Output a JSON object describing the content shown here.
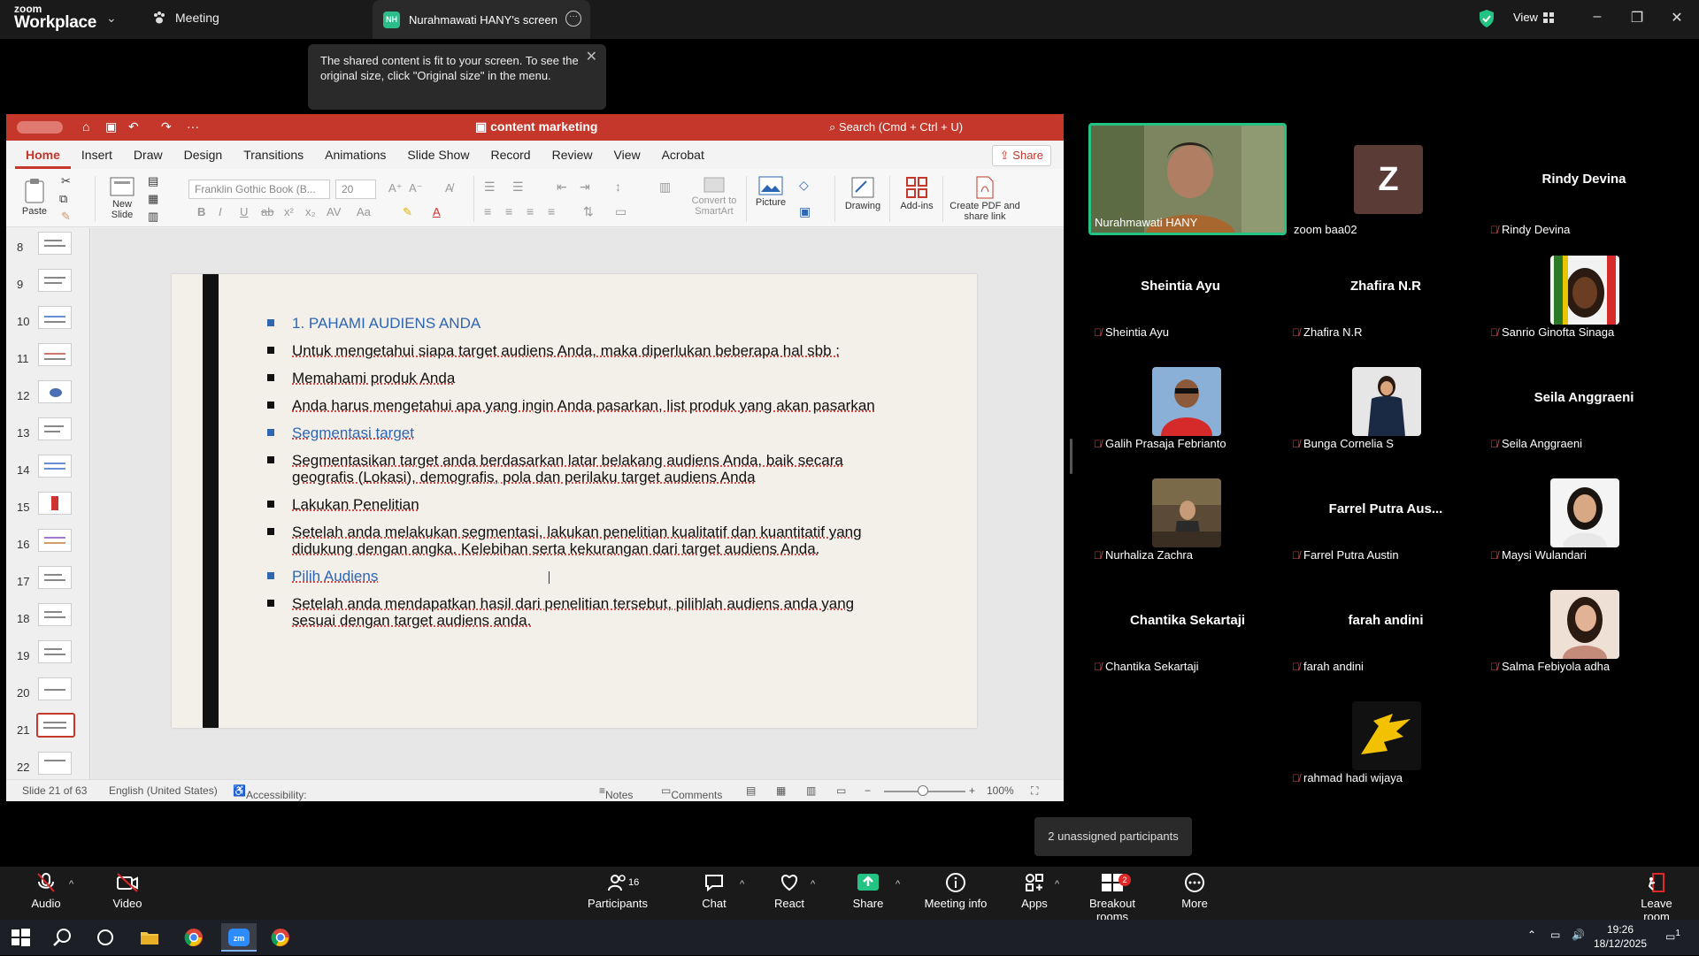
{
  "zoom": {
    "brand_small": "zoom",
    "brand_big": "Workplace",
    "meeting_label": "Meeting",
    "share_tab_initials": "NH",
    "share_tab_label": "Nurahmawati HANY's screen",
    "view_label": "View",
    "notice_text": "The shared content is fit to your screen. To see the original size, click \"Original size\" in the menu."
  },
  "ppt": {
    "doc_title": "content marketing",
    "search_placeholder": "Search (Cmd + Ctrl + U)",
    "tabs": [
      "Home",
      "Insert",
      "Draw",
      "Design",
      "Transitions",
      "Animations",
      "Slide Show",
      "Record",
      "Review",
      "View",
      "Acrobat"
    ],
    "share_label": "Share",
    "ribbon": {
      "paste": "Paste",
      "new_slide": "New Slide",
      "font_name": "Franklin Gothic Book (B...",
      "font_size": "20",
      "convert_smartart": "Convert to SmartArt",
      "picture": "Picture",
      "drawing": "Drawing",
      "addins": "Add-ins",
      "create_pdf": "Create PDF and share link"
    },
    "thumbnail_numbers": [
      "8",
      "9",
      "10",
      "11",
      "12",
      "13",
      "14",
      "15",
      "16",
      "17",
      "18",
      "19",
      "20",
      "21",
      "22"
    ],
    "selected_slide": "21",
    "slide_lines": [
      {
        "text": "1. PAHAMI AUDIENS ANDA",
        "style": "blue"
      },
      {
        "text": "Untuk mengetahui siapa target audiens Anda, maka diperlukan beberapa hal sbb :",
        "style": "ul"
      },
      {
        "text": "Memahami produk Anda",
        "style": "ul"
      },
      {
        "text": "Anda harus mengetahui apa yang ingin Anda pasarkan, list produk yang akan pasarkan",
        "style": "ul"
      },
      {
        "text": "Segmentasi target",
        "style": "blue ul"
      },
      {
        "text": "Segmentasikan target anda berdasarkan latar belakang audiens Anda, baik secara geografis (Lokasi), demografis, pola dan perilaku target audiens Anda",
        "style": "ul"
      },
      {
        "text": "Lakukan Penelitian",
        "style": "ul"
      },
      {
        "text": "Setelah anda melakukan segmentasi, lakukan penelitian kualitatif dan kuantitatif yang didukung dengan angka. Kelebihan serta kekurangan dari target audiens Anda.",
        "style": "ul"
      },
      {
        "text": "Pilih Audiens",
        "style": "blue ul"
      },
      {
        "text": "Setelah anda mendapatkan hasil dari penelitian tersebut, pilihlah audiens anda yang sesuai dengan target audiens anda.",
        "style": "ul"
      }
    ],
    "status": {
      "slide_count": "Slide 21 of 63",
      "language": "English (United States)",
      "accessibility": "Accessibility: Investigate",
      "notes": "Notes",
      "comments": "Comments",
      "zoom": "100%"
    }
  },
  "participants": [
    {
      "name": "Nurahmawati HANY",
      "type": "video",
      "active": true
    },
    {
      "name": "zoom baa02",
      "type": "avatar",
      "initial": "Z"
    },
    {
      "name": "Rindy Devina",
      "type": "name"
    },
    {
      "name": "Sheintia Ayu",
      "type": "name"
    },
    {
      "name": "Zhafira N.R",
      "type": "name"
    },
    {
      "name": "Sanrio Ginofta Sinaga",
      "type": "photo"
    },
    {
      "name": "Galih Prasaja Febrianto",
      "type": "photo"
    },
    {
      "name": "Bunga Cornelia S",
      "type": "photo"
    },
    {
      "name": "Seila Anggraeni",
      "type": "name"
    },
    {
      "name": "Nurhaliza Zachra",
      "type": "photo"
    },
    {
      "name": "Farrel Putra Austin",
      "type": "name",
      "center_label": "Farrel Putra Aus..."
    },
    {
      "name": "Maysi Wulandari",
      "type": "photo"
    },
    {
      "name": "Chantika Sekartaji",
      "type": "name"
    },
    {
      "name": "farah andini",
      "type": "name"
    },
    {
      "name": "Salma Febiyola adha",
      "type": "photo"
    },
    {
      "name": "rahmad hadi wijaya",
      "type": "photo"
    }
  ],
  "unassigned": "2 unassigned participants",
  "toolbar": {
    "audio": "Audio",
    "video": "Video",
    "participants": "Participants",
    "participants_count": "16",
    "chat": "Chat",
    "react": "React",
    "share": "Share",
    "meeting_info": "Meeting info",
    "apps": "Apps",
    "breakout": "Breakout rooms",
    "breakout_badge": "2",
    "more": "More",
    "leave": "Leave room"
  },
  "taskbar": {
    "time": "19:26",
    "date": "18/12/2025",
    "notif_count": "1"
  },
  "colors": {
    "ppt_accent": "#c4372a",
    "zoom_green": "#23c483",
    "slide_blue": "#2f66b3",
    "mute_red": "#e04a4a"
  }
}
